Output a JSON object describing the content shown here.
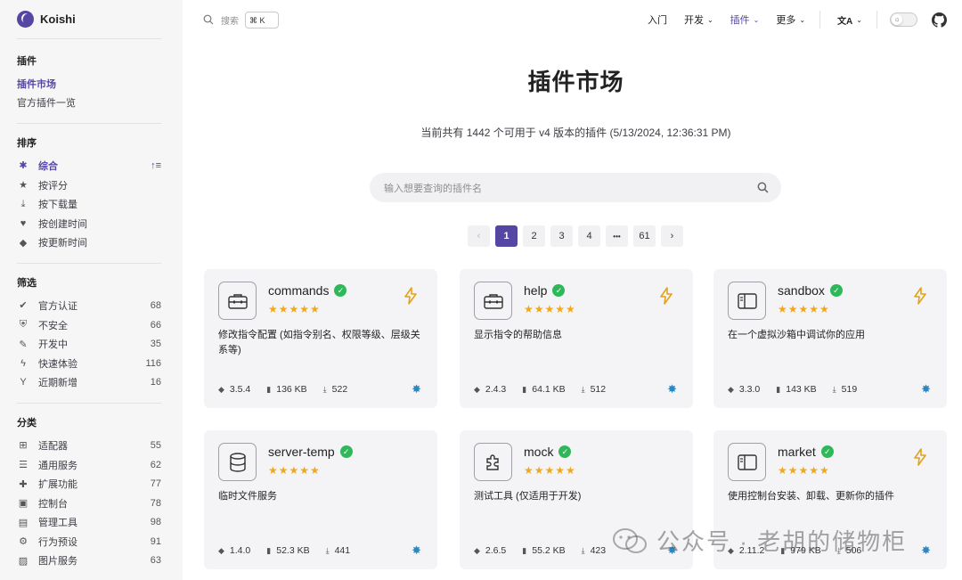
{
  "brand": {
    "name": "Koishi"
  },
  "sidebar": {
    "plugins": {
      "title": "插件",
      "items": [
        {
          "label": "插件市场",
          "active": true
        },
        {
          "label": "官方插件一览",
          "active": false
        }
      ]
    },
    "sort": {
      "title": "排序",
      "toggle": "↑≡",
      "items": [
        {
          "label": "综合",
          "icon": "asterisk-icon",
          "active": true
        },
        {
          "label": "按评分",
          "icon": "star-icon"
        },
        {
          "label": "按下载量",
          "icon": "download-icon"
        },
        {
          "label": "按创建时间",
          "icon": "heartbeat-icon"
        },
        {
          "label": "按更新时间",
          "icon": "tag-icon"
        }
      ]
    },
    "filter": {
      "title": "筛选",
      "items": [
        {
          "label": "官方认证",
          "count": "68",
          "icon": "check-circle-icon"
        },
        {
          "label": "不安全",
          "count": "66",
          "icon": "shield-icon"
        },
        {
          "label": "开发中",
          "count": "35",
          "icon": "wrench-icon"
        },
        {
          "label": "快速体验",
          "count": "116",
          "icon": "bolt-icon"
        },
        {
          "label": "近期新增",
          "count": "16",
          "icon": "seedling-icon"
        }
      ]
    },
    "category": {
      "title": "分类",
      "items": [
        {
          "label": "适配器",
          "count": "55",
          "icon": "sitemap-icon"
        },
        {
          "label": "通用服务",
          "count": "62",
          "icon": "server-icon"
        },
        {
          "label": "扩展功能",
          "count": "77",
          "icon": "puzzle-icon"
        },
        {
          "label": "控制台",
          "count": "78",
          "icon": "window-icon"
        },
        {
          "label": "管理工具",
          "count": "98",
          "icon": "toolbox-icon"
        },
        {
          "label": "行为预设",
          "count": "91",
          "icon": "gear-icon"
        },
        {
          "label": "图片服务",
          "count": "63",
          "icon": "image-icon"
        }
      ]
    }
  },
  "topnav": {
    "search_label": "搜索",
    "search_kbd": "⌘ K",
    "items": [
      {
        "label": "入门",
        "dropdown": false,
        "active": false
      },
      {
        "label": "开发",
        "dropdown": true,
        "active": false
      },
      {
        "label": "插件",
        "dropdown": true,
        "active": true
      },
      {
        "label": "更多",
        "dropdown": true,
        "active": false
      }
    ],
    "lang": "文A",
    "chev": "⌄"
  },
  "main": {
    "title": "插件市场",
    "subtitle": "当前共有 1442 个可用于 v4 版本的插件 (5/13/2024, 12:36:31 PM)",
    "search_placeholder": "输入想要查询的插件名",
    "pager": {
      "prev": "‹",
      "next": "›",
      "pages": [
        "1",
        "2",
        "3",
        "4",
        "•••",
        "61"
      ],
      "current": "1"
    }
  },
  "cards": [
    {
      "name": "commands",
      "icon": "toolbox-icon",
      "stars": "★★★★★",
      "bolt": true,
      "desc": "修改指令配置 (如指令别名、权限等级、层级关系等)",
      "version": "3.5.4",
      "size": "136 KB",
      "downloads": "522"
    },
    {
      "name": "help",
      "icon": "toolbox-icon",
      "stars": "★★★★★",
      "bolt": true,
      "desc": "显示指令的帮助信息",
      "version": "2.4.3",
      "size": "64.1 KB",
      "downloads": "512"
    },
    {
      "name": "sandbox",
      "icon": "window-icon",
      "stars": "★★★★★",
      "bolt": true,
      "desc": "在一个虚拟沙箱中调试你的应用",
      "version": "3.3.0",
      "size": "143 KB",
      "downloads": "519"
    },
    {
      "name": "server-temp",
      "icon": "database-icon",
      "stars": "★★★★★",
      "bolt": false,
      "desc": "临时文件服务",
      "version": "1.4.0",
      "size": "52.3 KB",
      "downloads": "441"
    },
    {
      "name": "mock",
      "icon": "puzzle-icon",
      "stars": "★★★★★",
      "bolt": false,
      "desc": "测试工具 (仅适用于开发)",
      "version": "2.6.5",
      "size": "55.2 KB",
      "downloads": "423"
    },
    {
      "name": "market",
      "icon": "window-icon",
      "stars": "★★★★★",
      "bolt": true,
      "desc": "使用控制台安装、卸载、更新你的插件",
      "version": "2.11.2",
      "size": "979 KB",
      "downloads": "506"
    }
  ],
  "watermark": {
    "text": "公众号 · 老胡的储物柜"
  },
  "colors": {
    "accent": "#5546a3",
    "verified": "#2fb85a",
    "star": "#f0a81b",
    "bolt": "#e2a21b"
  }
}
